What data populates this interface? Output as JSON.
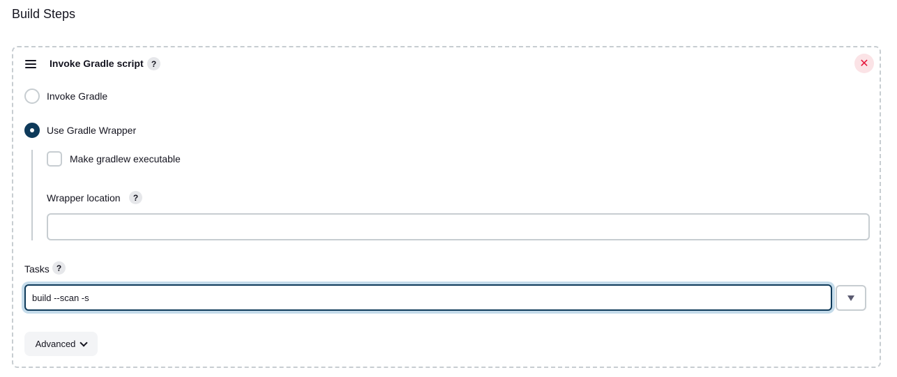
{
  "section": {
    "title": "Build Steps"
  },
  "step": {
    "title": "Invoke Gradle script",
    "help_icon": "question-mark",
    "close_icon": "close-x",
    "drag_icon": "hamburger-lines",
    "options": [
      {
        "label": "Invoke Gradle",
        "selected": false
      },
      {
        "label": "Use Gradle Wrapper",
        "selected": true
      }
    ],
    "wrapper": {
      "make_executable_label": "Make gradlew executable",
      "make_executable_checked": false,
      "location_label": "Wrapper location",
      "location_value": ""
    },
    "tasks": {
      "label": "Tasks",
      "value": "build --scan -s"
    },
    "advanced_label": "Advanced"
  },
  "colors": {
    "accent": "#0e3a5a",
    "danger": "#e5163b",
    "border": "#c7cdd1"
  }
}
